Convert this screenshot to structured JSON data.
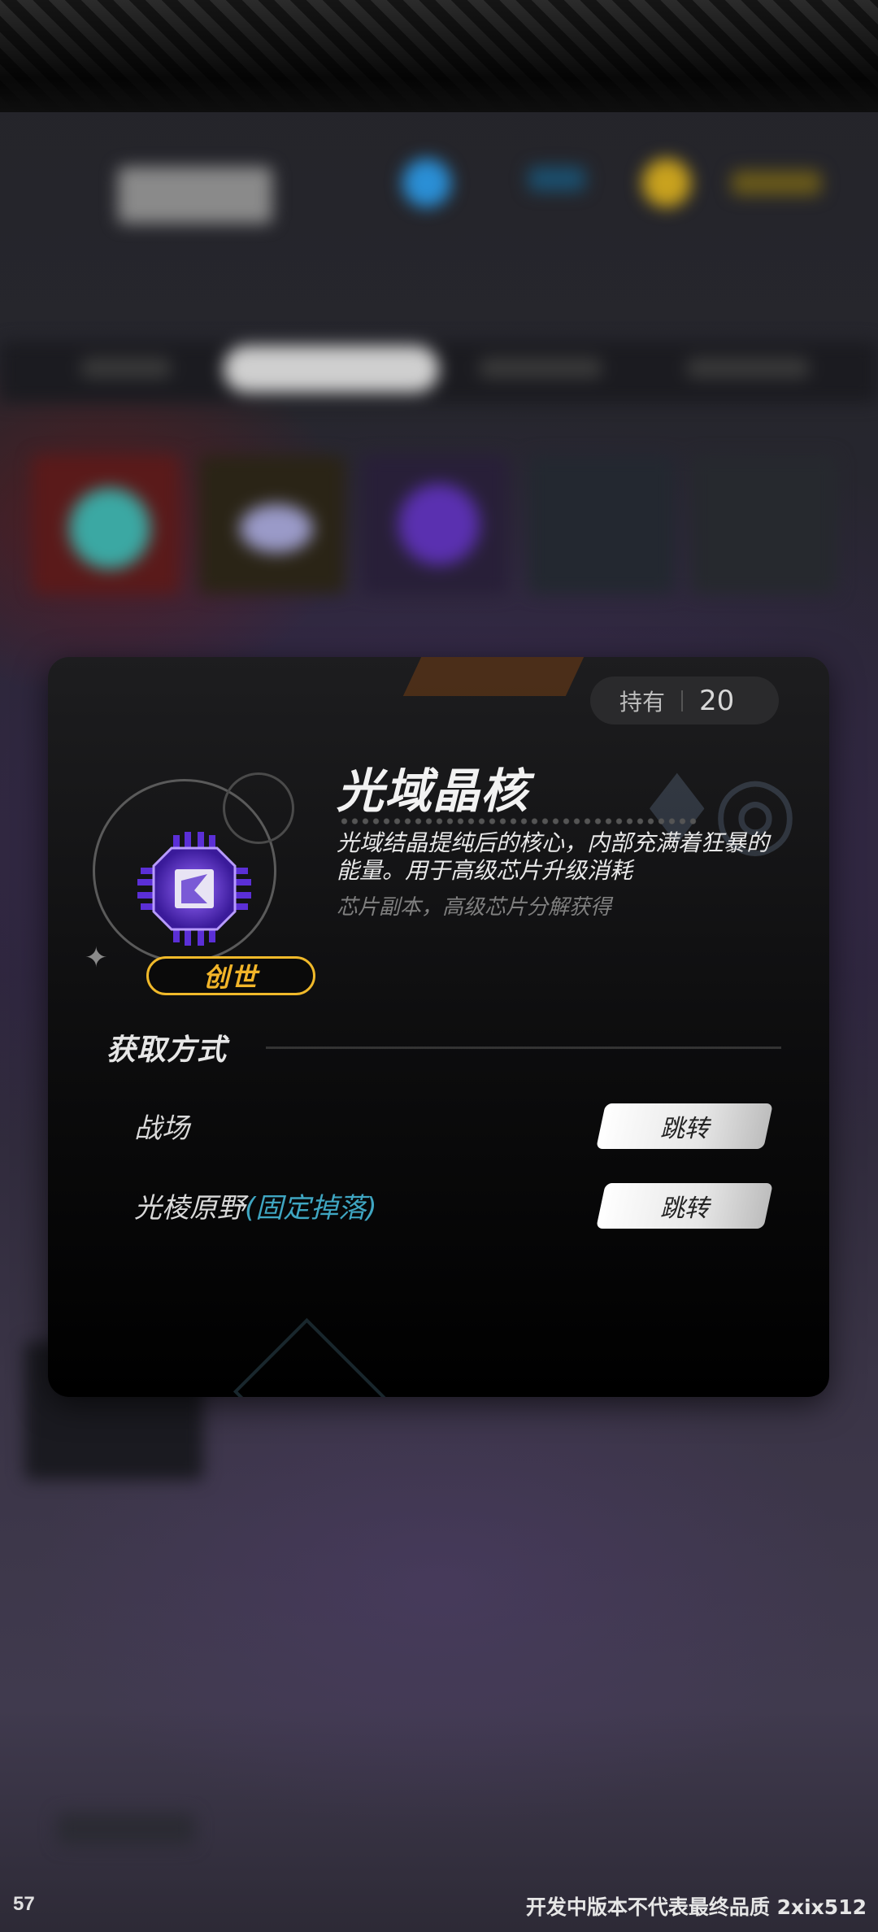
{
  "dialog": {
    "hold": {
      "label": "持有",
      "count": "20"
    },
    "item": {
      "name": "光域晶核",
      "rarity": "创世",
      "description": "光域结晶提纯后的核心，内部充满着狂暴的能量。用于高级芯片升级消耗",
      "source": "芯片副本，高级芯片分解获得",
      "icon": "purple-chip-icon"
    },
    "acquire": {
      "title": "获取方式",
      "rows": [
        {
          "label": "战场",
          "note": "",
          "button": "跳转"
        },
        {
          "label": "光棱原野",
          "note": "(固定掉落)",
          "button": "跳转"
        }
      ]
    }
  },
  "footer": {
    "fps": "57",
    "watermark": "开发中版本不代表最终品质 2xix512"
  },
  "colors": {
    "rarity_gold": "#f2b529",
    "highlight_blue": "#3fa6c2",
    "dialog_bg": "#0c0c0d"
  }
}
